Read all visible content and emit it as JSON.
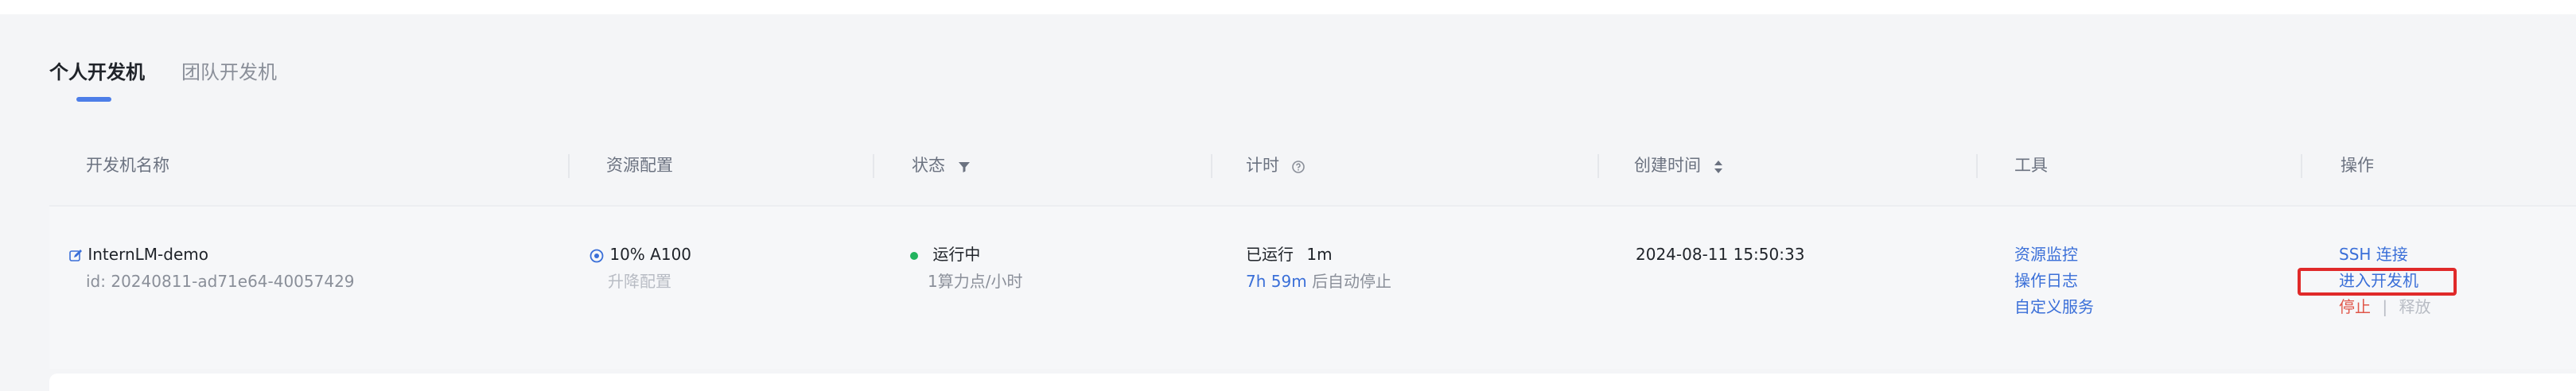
{
  "tabs": [
    {
      "label": "个人开发机",
      "active": true
    },
    {
      "label": "团队开发机",
      "active": false
    }
  ],
  "columns": {
    "name": "开发机名称",
    "resource": "资源配置",
    "status": "状态",
    "timer": "计时",
    "created": "创建时间",
    "tools": "工具",
    "actions": "操作"
  },
  "row": {
    "name": "InternLM-demo",
    "id": "id: 20240811-ad71e64-40057429",
    "resource": "10% A100",
    "resource_action": "升降配置",
    "status": "运行中",
    "status_detail": "1算力点/小时",
    "timer_label": "已运行",
    "timer_value": "1m",
    "auto_stop_time": "7h 59m",
    "auto_stop_text": "后自动停止",
    "created": "2024-08-11 15:50:33",
    "tools": [
      "资源监控",
      "操作日志",
      "自定义服务"
    ],
    "actions": {
      "ssh": "SSH 连接",
      "enter": "进入开发机",
      "stop": "停止",
      "separator": "|",
      "release": "释放"
    }
  },
  "colors": {
    "accent": "#3a6fd8",
    "running": "#22b35e",
    "danger": "#e0574a",
    "highlight": "#e02a2a"
  },
  "icons": [
    "filter-icon",
    "help-circle-icon",
    "sort-icon",
    "edit-icon",
    "gpu-icon"
  ]
}
